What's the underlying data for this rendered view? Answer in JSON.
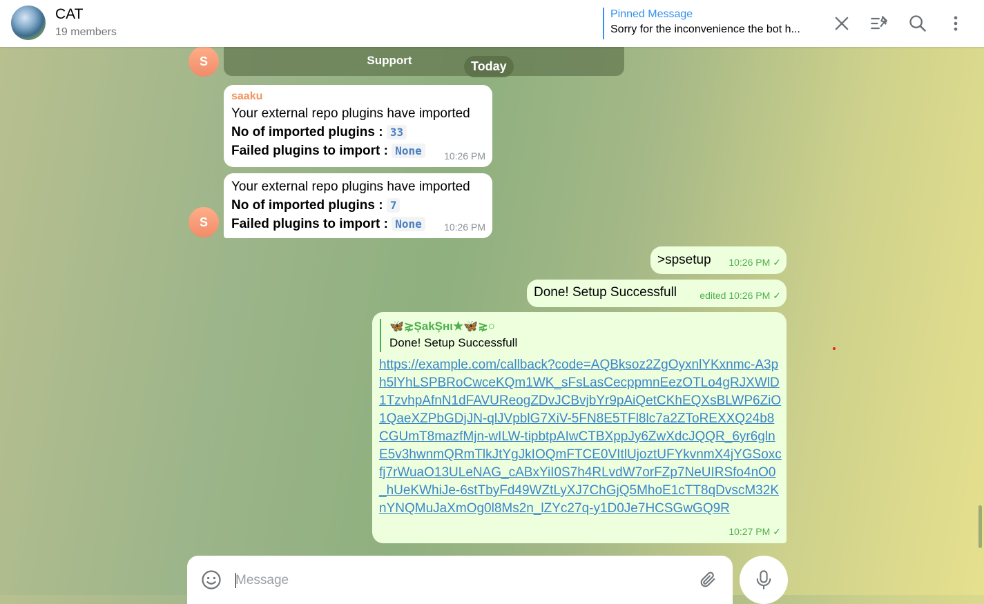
{
  "header": {
    "title": "CAT",
    "subtitle": "19 members",
    "pinned_title": "Pinned Message",
    "pinned_text": "Sorry for the inconvenience the bot h..."
  },
  "topbar": {
    "support_label": "Support",
    "today_label": "Today"
  },
  "avatars": {
    "user_initial": "S"
  },
  "messages": [
    {
      "sender": "saaku",
      "line1": "Your external repo plugins have imported",
      "count_label": "No of imported plugins :",
      "count_value": "33",
      "failed_label": "Failed plugins to import :",
      "failed_value": "None",
      "time": "10:26 PM"
    },
    {
      "line1": "Your external repo plugins have imported",
      "count_label": "No of imported plugins :",
      "count_value": "7",
      "failed_label": "Failed plugins to import :",
      "failed_value": "None",
      "time": "10:26 PM"
    }
  ],
  "outgoing": [
    {
      "text": ">spsetup",
      "time": "10:26 PM"
    },
    {
      "text": "Done! Setup Successfull",
      "time": "edited 10:26 PM"
    },
    {
      "reply_name": "🦋⋧ȘakȘʜι★🦋⋧○",
      "reply_text": "Done! Setup Successfull",
      "link": "https://example.com/callback?code=AQBksoz2ZgOyxnlYKxnmc-A3ph5lYhLSPBRoCwceKQm1WK_sFsLasCecppmnEezOTLo4gRJXWlD1TzvhpAfnN1dFAVUReogZDvJCBvjbYr9pAiQetCKhEQXsBLWP6ZiO1QaeXZPbGDjJN-qlJVpblG7XiV-5FN8E5TFl8lc7a2ZToREXXQ24b8CGUmT8mazfMjn-wILW-tipbtpAIwCTBXppJy6ZwXdcJQQR_6yr6glnE5v3hwnmQRmTlkJtYgJkIOQmFTCE0VItlUjoztUFYkvnmX4jYGSoxcfj7rWuaO13ULeNAG_cABxYiI0S7h4RLvdW7orFZp7NeUIRSfo4nO0_hUeKWhiJe-6stTbyFd49WZtLyXJ7ChGjQ5MhoE1cTT8qDvscM32KnYNQMuJaXmOg0l8Ms2n_lZYc27q-y1D0Je7HCSGwGQ9R",
      "time": "10:27 PM"
    }
  ],
  "composer": {
    "placeholder": "Message"
  },
  "icons": {
    "close": "close-icon",
    "unpin": "pinned-list-icon",
    "search": "search-icon",
    "more": "more-vertical-icon",
    "emoji": "emoji-icon",
    "attach": "paperclip-icon",
    "mic": "microphone-icon"
  },
  "colors": {
    "accent": "#3390ec",
    "outgoing_bubble": "#eeffde",
    "outgoing_time": "#4fae4e",
    "sender_name": "#f0955f",
    "link": "#3a86c8"
  }
}
